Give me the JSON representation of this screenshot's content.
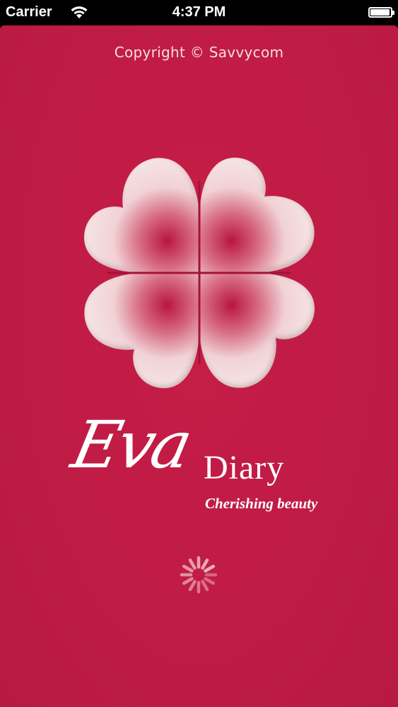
{
  "status_bar": {
    "carrier": "Carrier",
    "time": "4:37 PM",
    "battery_level": 0.95,
    "wifi_icon": "wifi-icon",
    "battery_icon": "battery-icon"
  },
  "splash": {
    "copyright": "Copyright © Savvycom",
    "logo_icon": "four-heart-clover-icon",
    "brand_part1": "Eva",
    "brand_part2": "Diary",
    "tagline": "Cherishing beauty",
    "loading_icon": "loading-spinner-icon"
  },
  "colors": {
    "background": "#bf1c45",
    "petal": "#f7ebe8",
    "petal_shadow": "#b8163f",
    "text": "#ffffff"
  }
}
